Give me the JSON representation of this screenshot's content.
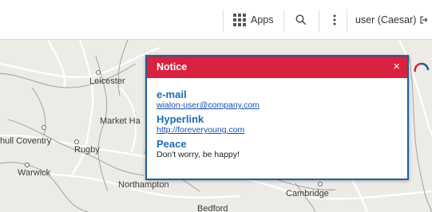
{
  "topbar": {
    "apps_label": "Apps",
    "user_label": "user (Caesar)"
  },
  "map": {
    "places": {
      "leicester": "Leicester",
      "market_harborough": "Market Ha",
      "coventry": "hull  Coventry",
      "rugby": "Rugby",
      "warwick": "Warwick",
      "northampton": "Northampton",
      "cambridge": "Cambridge",
      "bedford": "Bedford"
    }
  },
  "notice": {
    "title": "Notice",
    "close_glyph": "×",
    "items": [
      {
        "heading": "e-mail",
        "value": "wialon-user@company.com"
      },
      {
        "heading": "Hyperlink",
        "value": "http://foreveryoung.com"
      },
      {
        "heading": "Peace",
        "value": "Don't worry, be happy!"
      }
    ]
  },
  "colors": {
    "notice_header": "#d8223f",
    "notice_border": "#1e5f99",
    "heading_blue": "#1e6bb4"
  }
}
